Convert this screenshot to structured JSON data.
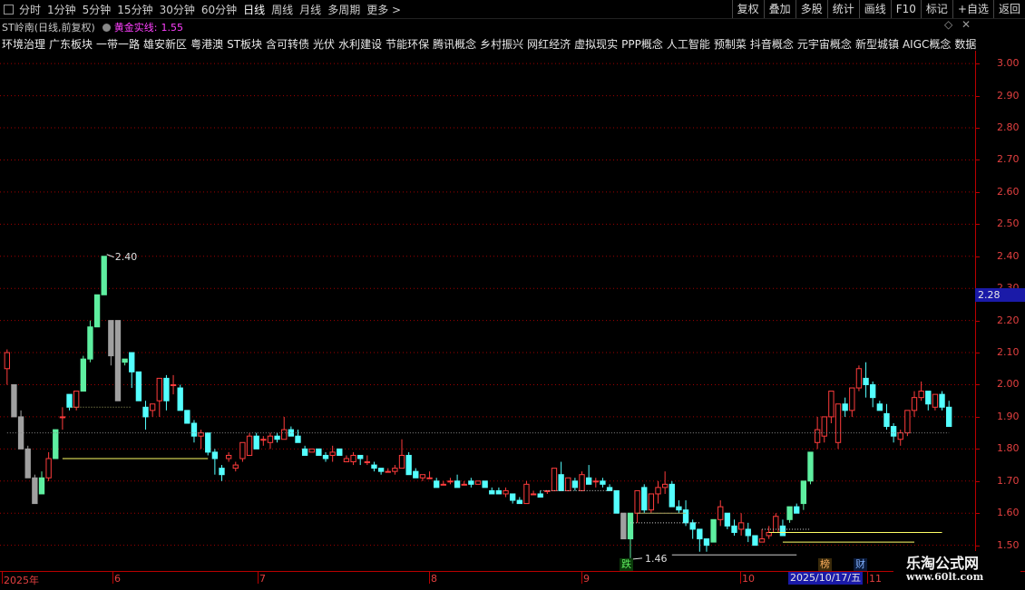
{
  "toolbar": {
    "periods": [
      "分时",
      "1分钟",
      "5分钟",
      "15分钟",
      "30分钟",
      "60分钟",
      "日线",
      "周线",
      "月线",
      "多周期",
      "更多 >"
    ],
    "active_period": "日线",
    "right_buttons": [
      "复权",
      "叠加",
      "多股",
      "统计",
      "画线",
      "F10",
      "+自选",
      "返回"
    ],
    "mark_label": "标记"
  },
  "stock": {
    "name": "ST岭南(日线,前复权)",
    "indicator_name": "黄金实线",
    "indicator_value": "1.55"
  },
  "concepts": [
    "环境治理",
    "广东板块",
    "一带一路",
    "雄安新区",
    "粤港澳",
    "ST板块",
    "含可转债",
    "光伏",
    "水利建设",
    "节能环保",
    "腾讯概念",
    "乡村振兴",
    "网红经济",
    "虚拟现实",
    "PPP概念",
    "人工智能",
    "预制菜",
    "抖音概念",
    "元宇宙概念",
    "新型城镇",
    "AIGC概念",
    "数据确权"
  ],
  "price_axis": {
    "labels": [
      "3.00",
      "2.90",
      "2.80",
      "2.70",
      "2.60",
      "2.50",
      "2.40",
      "2.30",
      "2.20",
      "2.10",
      "2.00",
      "1.90",
      "1.80",
      "1.70",
      "1.60",
      "1.50"
    ],
    "current_price": "2.28"
  },
  "annotations": {
    "high_label": "2.40",
    "low_label": "1.46"
  },
  "date_axis": {
    "labels": [
      "2025年",
      "6",
      "7",
      "8",
      "9",
      "10",
      "11"
    ],
    "current_date": "2025/10/17/五"
  },
  "badges": {
    "drop": "跌",
    "rank": "榜",
    "finance": "财"
  },
  "watermark": {
    "title": "乐淘公式网",
    "url": "www.60lt.com"
  },
  "colors": {
    "up": "#ff3c3c",
    "down": "#54ffff",
    "limit_up": "#5eefa0",
    "limit_down": "#a0a0a0",
    "grid": "#a00000",
    "indicator": "#ff40ff",
    "support_line": "#ffff66"
  },
  "chart_data": {
    "type": "candlestick",
    "ylim": [
      1.42,
      3.04
    ],
    "candles": [
      [
        2.05,
        2.11,
        2.0,
        2.1
      ],
      [
        2.0,
        2.0,
        1.9,
        1.9
      ],
      [
        1.9,
        1.92,
        1.8,
        1.8
      ],
      [
        1.8,
        1.81,
        1.71,
        1.71
      ],
      [
        1.71,
        1.72,
        1.63,
        1.63
      ],
      [
        1.66,
        1.73,
        1.66,
        1.71
      ],
      [
        1.71,
        1.79,
        1.7,
        1.77
      ],
      [
        1.77,
        1.86,
        1.77,
        1.86
      ],
      [
        1.9,
        1.93,
        1.86,
        1.9
      ],
      [
        1.97,
        1.97,
        1.92,
        1.93
      ],
      [
        1.93,
        1.98,
        1.92,
        1.98
      ],
      [
        1.98,
        2.09,
        1.98,
        2.08
      ],
      [
        2.08,
        2.2,
        2.07,
        2.18
      ],
      [
        2.18,
        2.28,
        2.18,
        2.28
      ],
      [
        2.28,
        2.4,
        2.28,
        2.4
      ],
      [
        2.2,
        2.2,
        2.06,
        2.09
      ],
      [
        2.2,
        2.2,
        1.95,
        1.95
      ],
      [
        2.07,
        2.08,
        2.06,
        2.08
      ],
      [
        2.1,
        2.1,
        1.99,
        2.04
      ],
      [
        2.04,
        2.04,
        1.95,
        1.95
      ],
      [
        1.93,
        1.95,
        1.86,
        1.9
      ],
      [
        1.92,
        1.94,
        1.9,
        1.94
      ],
      [
        1.95,
        2.02,
        1.9,
        2.02
      ],
      [
        2.02,
        2.03,
        1.92,
        1.95
      ],
      [
        2.0,
        2.03,
        1.97,
        2.0
      ],
      [
        1.99,
        2.0,
        1.93,
        1.92
      ],
      [
        1.92,
        1.92,
        1.88,
        1.88
      ],
      [
        1.88,
        1.89,
        1.82,
        1.84
      ],
      [
        1.84,
        1.86,
        1.8,
        1.85
      ],
      [
        1.85,
        1.85,
        1.78,
        1.79
      ],
      [
        1.79,
        1.8,
        1.72,
        1.77
      ],
      [
        1.74,
        1.75,
        1.7,
        1.72
      ],
      [
        1.77,
        1.79,
        1.76,
        1.78
      ],
      [
        1.74,
        1.76,
        1.73,
        1.75
      ],
      [
        1.77,
        1.82,
        1.76,
        1.82
      ],
      [
        1.78,
        1.85,
        1.78,
        1.84
      ],
      [
        1.84,
        1.85,
        1.8,
        1.8
      ],
      [
        1.83,
        1.84,
        1.81,
        1.83
      ],
      [
        1.82,
        1.85,
        1.8,
        1.84
      ],
      [
        1.84,
        1.85,
        1.82,
        1.83
      ],
      [
        1.83,
        1.9,
        1.83,
        1.86
      ],
      [
        1.86,
        1.87,
        1.84,
        1.84
      ],
      [
        1.84,
        1.86,
        1.82,
        1.82
      ],
      [
        1.8,
        1.81,
        1.78,
        1.78
      ],
      [
        1.79,
        1.8,
        1.79,
        1.8
      ],
      [
        1.8,
        1.8,
        1.78,
        1.78
      ],
      [
        1.78,
        1.79,
        1.76,
        1.77
      ],
      [
        1.78,
        1.81,
        1.76,
        1.79
      ],
      [
        1.8,
        1.8,
        1.78,
        1.78
      ],
      [
        1.76,
        1.78,
        1.76,
        1.77
      ],
      [
        1.76,
        1.79,
        1.75,
        1.78
      ],
      [
        1.78,
        1.78,
        1.75,
        1.77
      ],
      [
        1.76,
        1.78,
        1.75,
        1.76
      ],
      [
        1.75,
        1.76,
        1.73,
        1.74
      ],
      [
        1.74,
        1.74,
        1.72,
        1.73
      ],
      [
        1.73,
        1.74,
        1.73,
        1.73
      ],
      [
        1.73,
        1.75,
        1.72,
        1.74
      ],
      [
        1.74,
        1.83,
        1.74,
        1.78
      ],
      [
        1.78,
        1.79,
        1.72,
        1.72
      ],
      [
        1.73,
        1.74,
        1.71,
        1.71
      ],
      [
        1.71,
        1.72,
        1.7,
        1.72
      ],
      [
        1.71,
        1.73,
        1.71,
        1.71
      ],
      [
        1.7,
        1.71,
        1.68,
        1.68
      ],
      [
        1.69,
        1.7,
        1.69,
        1.69
      ],
      [
        1.7,
        1.71,
        1.69,
        1.7
      ],
      [
        1.7,
        1.72,
        1.68,
        1.68
      ],
      [
        1.69,
        1.7,
        1.69,
        1.69
      ],
      [
        1.7,
        1.71,
        1.68,
        1.69
      ],
      [
        1.69,
        1.7,
        1.69,
        1.7
      ],
      [
        1.7,
        1.7,
        1.68,
        1.68
      ],
      [
        1.67,
        1.68,
        1.66,
        1.66
      ],
      [
        1.67,
        1.68,
        1.66,
        1.66
      ],
      [
        1.66,
        1.68,
        1.65,
        1.67
      ],
      [
        1.66,
        1.66,
        1.63,
        1.64
      ],
      [
        1.64,
        1.65,
        1.63,
        1.63
      ],
      [
        1.63,
        1.7,
        1.63,
        1.69
      ],
      [
        1.66,
        1.67,
        1.66,
        1.66
      ],
      [
        1.66,
        1.67,
        1.65,
        1.65
      ],
      [
        1.67,
        1.67,
        1.66,
        1.67
      ],
      [
        1.67,
        1.74,
        1.67,
        1.74
      ],
      [
        1.72,
        1.76,
        1.7,
        1.67
      ],
      [
        1.67,
        1.71,
        1.67,
        1.71
      ],
      [
        1.7,
        1.71,
        1.67,
        1.68
      ],
      [
        1.67,
        1.73,
        1.67,
        1.72
      ],
      [
        1.71,
        1.75,
        1.71,
        1.69
      ],
      [
        1.7,
        1.71,
        1.68,
        1.7
      ],
      [
        1.7,
        1.71,
        1.68,
        1.69
      ],
      [
        1.68,
        1.69,
        1.67,
        1.67
      ],
      [
        1.67,
        1.67,
        1.6,
        1.6
      ],
      [
        1.6,
        1.6,
        1.52,
        1.52
      ],
      [
        1.52,
        1.6,
        1.46,
        1.6
      ],
      [
        1.6,
        1.67,
        1.57,
        1.67
      ],
      [
        1.68,
        1.69,
        1.6,
        1.61
      ],
      [
        1.61,
        1.66,
        1.6,
        1.66
      ],
      [
        1.66,
        1.7,
        1.63,
        1.68
      ],
      [
        1.68,
        1.73,
        1.66,
        1.69
      ],
      [
        1.69,
        1.7,
        1.62,
        1.62
      ],
      [
        1.62,
        1.64,
        1.6,
        1.61
      ],
      [
        1.61,
        1.64,
        1.56,
        1.57
      ],
      [
        1.57,
        1.58,
        1.52,
        1.55
      ],
      [
        1.55,
        1.55,
        1.48,
        1.52
      ],
      [
        1.52,
        1.52,
        1.48,
        1.5
      ],
      [
        1.51,
        1.58,
        1.51,
        1.58
      ],
      [
        1.58,
        1.64,
        1.56,
        1.62
      ],
      [
        1.6,
        1.6,
        1.55,
        1.56
      ],
      [
        1.56,
        1.58,
        1.53,
        1.54
      ],
      [
        1.55,
        1.6,
        1.53,
        1.57
      ],
      [
        1.55,
        1.57,
        1.51,
        1.53
      ],
      [
        1.53,
        1.53,
        1.5,
        1.5
      ],
      [
        1.51,
        1.55,
        1.51,
        1.52
      ],
      [
        1.53,
        1.56,
        1.52,
        1.54
      ],
      [
        1.54,
        1.6,
        1.54,
        1.59
      ],
      [
        1.56,
        1.58,
        1.53,
        1.53
      ],
      [
        1.58,
        1.62,
        1.57,
        1.62
      ],
      [
        1.62,
        1.63,
        1.6,
        1.6
      ],
      [
        1.63,
        1.7,
        1.61,
        1.7
      ],
      [
        1.7,
        1.79,
        1.69,
        1.79
      ],
      [
        1.82,
        1.9,
        1.8,
        1.86
      ],
      [
        1.84,
        1.9,
        1.82,
        1.9
      ],
      [
        1.9,
        1.98,
        1.88,
        1.98
      ],
      [
        1.82,
        1.94,
        1.8,
        1.94
      ],
      [
        1.94,
        1.96,
        1.9,
        1.92
      ],
      [
        1.92,
        1.99,
        1.9,
        1.99
      ],
      [
        1.99,
        2.06,
        1.98,
        2.05
      ],
      [
        2.02,
        2.07,
        1.96,
        2.0
      ],
      [
        2.0,
        2.01,
        1.93,
        1.96
      ],
      [
        1.94,
        1.95,
        1.92,
        1.92
      ],
      [
        1.91,
        1.94,
        1.86,
        1.87
      ],
      [
        1.87,
        1.88,
        1.82,
        1.84
      ],
      [
        1.83,
        1.86,
        1.81,
        1.85
      ],
      [
        1.85,
        1.92,
        1.84,
        1.92
      ],
      [
        1.92,
        1.98,
        1.9,
        1.96
      ],
      [
        1.96,
        2.01,
        1.95,
        1.98
      ],
      [
        1.98,
        1.98,
        1.92,
        1.94
      ],
      [
        1.93,
        1.97,
        1.92,
        1.97
      ],
      [
        1.97,
        1.98,
        1.92,
        1.93
      ],
      [
        1.93,
        1.95,
        1.87,
        1.87
      ]
    ],
    "horizontal_levels": [
      {
        "value": 1.85,
        "style": "dotted",
        "color": "#888888"
      },
      {
        "value": 1.77,
        "style": "solid",
        "color": "#ffff66"
      },
      {
        "value": 1.93,
        "style": "dotted",
        "color": "#aaaa66"
      },
      {
        "value": 1.67,
        "style": "dotted",
        "color": "#cccccc"
      },
      {
        "value": 1.6,
        "style": "solid",
        "color": "#aaaa66"
      },
      {
        "value": 1.57,
        "style": "dotted",
        "color": "#cccccc"
      },
      {
        "value": 1.55,
        "style": "dotted",
        "color": "#cccccc"
      },
      {
        "value": 1.54,
        "style": "solid",
        "color": "#ffff66"
      },
      {
        "value": 1.51,
        "style": "solid",
        "color": "#ffff66"
      },
      {
        "value": 1.47,
        "style": "solid",
        "color": "#cccccc"
      }
    ]
  }
}
